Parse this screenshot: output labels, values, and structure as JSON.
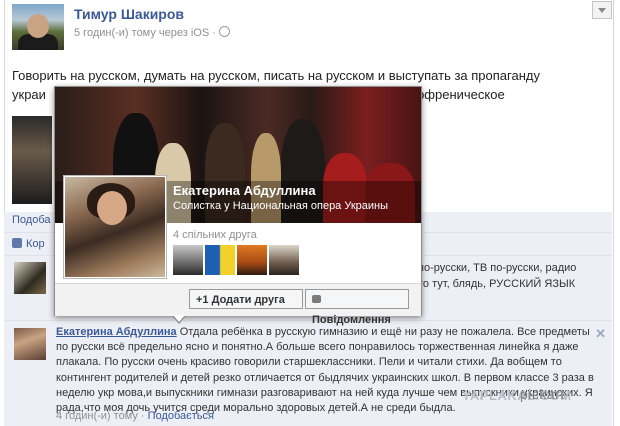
{
  "post": {
    "author": "Тимур Шакиров",
    "meta": "5 годин(-и) тому через iOS ·",
    "text_line1": "Говорить на русском, думать на русском, писать на русском и выступать за пропаганду",
    "text_line2_start": "украи",
    "text_line2_end": "изофреническое"
  },
  "actions": {
    "like_row": "Подоба",
    "likes_line": "Кор"
  },
  "comment1": {
    "right_text": "по-русски, ТВ по-русски, радио\nто тут, блядь, РУССКИЙ ЯЗЫК"
  },
  "comment2": {
    "name": "Екатерина Абдуллина",
    "text": "Отдала ребёнка в русскую гимназию и ещё ни разу не пожалела. Все предметы по русски всё предельно ясно и понятно.А больше всего понравилось торжественная линейка я даже плакала. По русски очень красиво говорили старшеклассники. Пели и читали стихи. Да вобщем то контингент родителей и детей резко отличается от быдлячих украинских школ. В первом классе 3 раза в неделю укр мова,и выпускники гимнази разговаривают на ней куда лучше чем выпускники украинских. Я рада,что моя дочь учится среди морально здоровых детей.А не среди быдла.",
    "time": "4 годин(-и) тому · ",
    "like": "Подобається",
    "close": "✕"
  },
  "hovercard": {
    "name": "Екатерина Абдуллина",
    "subtitle": "Солистка у Национальная опера Украины",
    "mutual": "4 спільних друга",
    "add_friend": "+1 Додати друга",
    "message": "Повідомлення"
  },
  "watermark": {
    "text": "YAPLAKAL.COM",
    "overlay": "pickart"
  },
  "icons": {
    "menu": "chevron-down-icon",
    "globe": "globe-icon",
    "like": "thumbs-up-icon",
    "message": "message-icon",
    "close": "close-icon"
  },
  "colors": {
    "link": "#3b5998",
    "muted": "#909090",
    "gray_panel": "#eceff5"
  }
}
